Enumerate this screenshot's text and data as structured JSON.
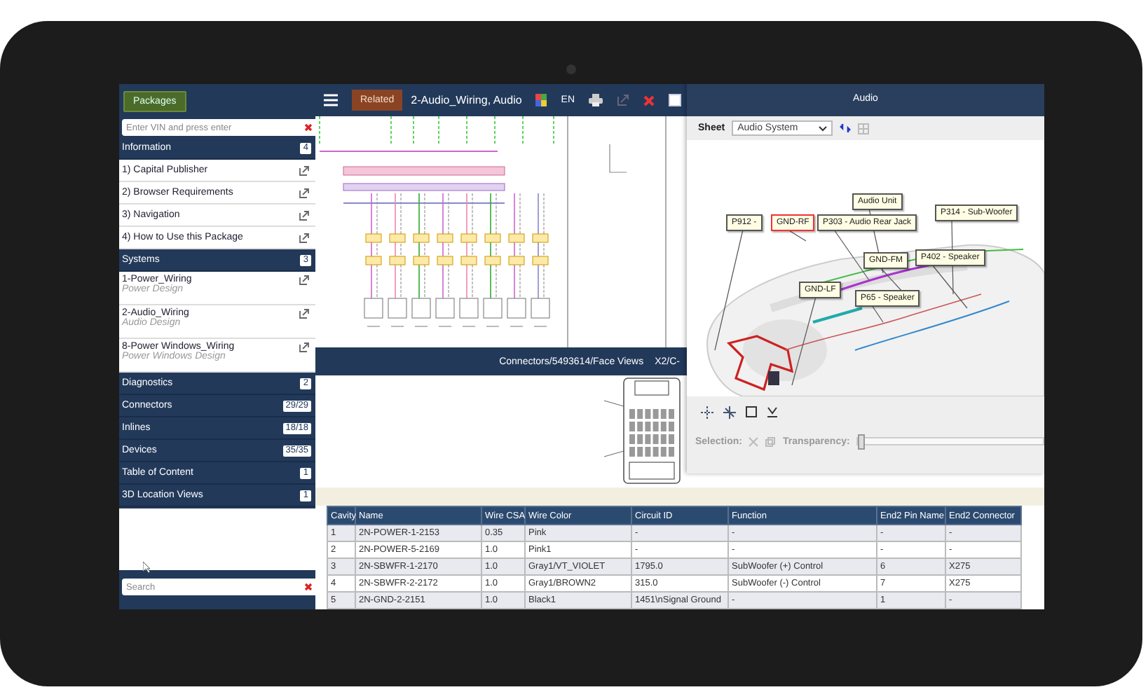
{
  "toolbar": {
    "related_button": "Related",
    "title": "2-Audio_Wiring, Audio",
    "language": "EN"
  },
  "sidebar": {
    "packages_button": "Packages",
    "vin_field": {
      "placeholder": "Enter VIN and press enter"
    },
    "sections": [
      {
        "title": "Information",
        "count": "4",
        "items": [
          {
            "label": "1) Capital Publisher"
          },
          {
            "label": "2) Browser Requirements"
          },
          {
            "label": "3) Navigation"
          },
          {
            "label": "4) How to Use this Package"
          }
        ]
      },
      {
        "title": "Systems",
        "count": "3",
        "items": [
          {
            "label": "1-Power_Wiring",
            "subtitle": "Power Design"
          },
          {
            "label": "2-Audio_Wiring",
            "subtitle": "Audio Design"
          },
          {
            "label": "8-Power Windows_Wiring",
            "subtitle": "Power Windows Design"
          }
        ]
      },
      {
        "title": "Diagnostics",
        "count": "2"
      },
      {
        "title": "Connectors",
        "count": "29/29"
      },
      {
        "title": "Inlines",
        "count": "18/18"
      },
      {
        "title": "Devices",
        "count": "35/35"
      },
      {
        "title": "Table of Content",
        "count": "1"
      },
      {
        "title": "3D Location Views",
        "count": "1"
      }
    ],
    "search_field": {
      "placeholder": "Search"
    }
  },
  "path_bar": {
    "path": "Connectors/5493614/Face Views",
    "connector": "X2/C-"
  },
  "viewer_panel": {
    "title": "Audio",
    "sheet_label": "Sheet",
    "sheet_select": "Audio System",
    "callouts": [
      {
        "text": "Audio Unit",
        "selected": false
      },
      {
        "text": "P912 -",
        "selected": false
      },
      {
        "text": "GND-RF",
        "selected": true
      },
      {
        "text": "P303 - Audio Rear Jack",
        "selected": false
      },
      {
        "text": "P314 - Sub-Woofer",
        "selected": false
      },
      {
        "text": "GND-FM",
        "selected": false
      },
      {
        "text": "P402 - Speaker",
        "selected": false
      },
      {
        "text": "GND-LF",
        "selected": false
      },
      {
        "text": "P65 - Speaker",
        "selected": false
      }
    ],
    "selection_label": "Selection:",
    "transparency_label": "Transparency:",
    "transparency": {
      "level": 0
    }
  },
  "table": {
    "columns": [
      "Cavity",
      "Name",
      "Wire CSA",
      "Wire Color",
      "Circuit ID",
      "Function",
      "End2 Pin Name",
      "End2 Connector"
    ],
    "rows": [
      [
        "1",
        "2N-POWER-1-2153",
        "0.35",
        "Pink",
        "-",
        "-",
        "-",
        "-"
      ],
      [
        "2",
        "2N-POWER-5-2169",
        "1.0",
        "Pink1",
        "-",
        "-",
        "-",
        "-"
      ],
      [
        "3",
        "2N-SBWFR-1-2170",
        "1.0",
        "Gray1/VT_VIOLET",
        "1795.0",
        "SubWoofer (+) Control",
        "6",
        "X275"
      ],
      [
        "4",
        "2N-SBWFR-2-2172",
        "1.0",
        "Gray1/BROWN2",
        "315.0",
        "SubWoofer (-) Control",
        "7",
        "X275"
      ],
      [
        "5",
        "2N-GND-2-2151",
        "1.0",
        "Black1",
        "1451\\nSignal Ground",
        "-",
        "1",
        "-"
      ]
    ]
  }
}
